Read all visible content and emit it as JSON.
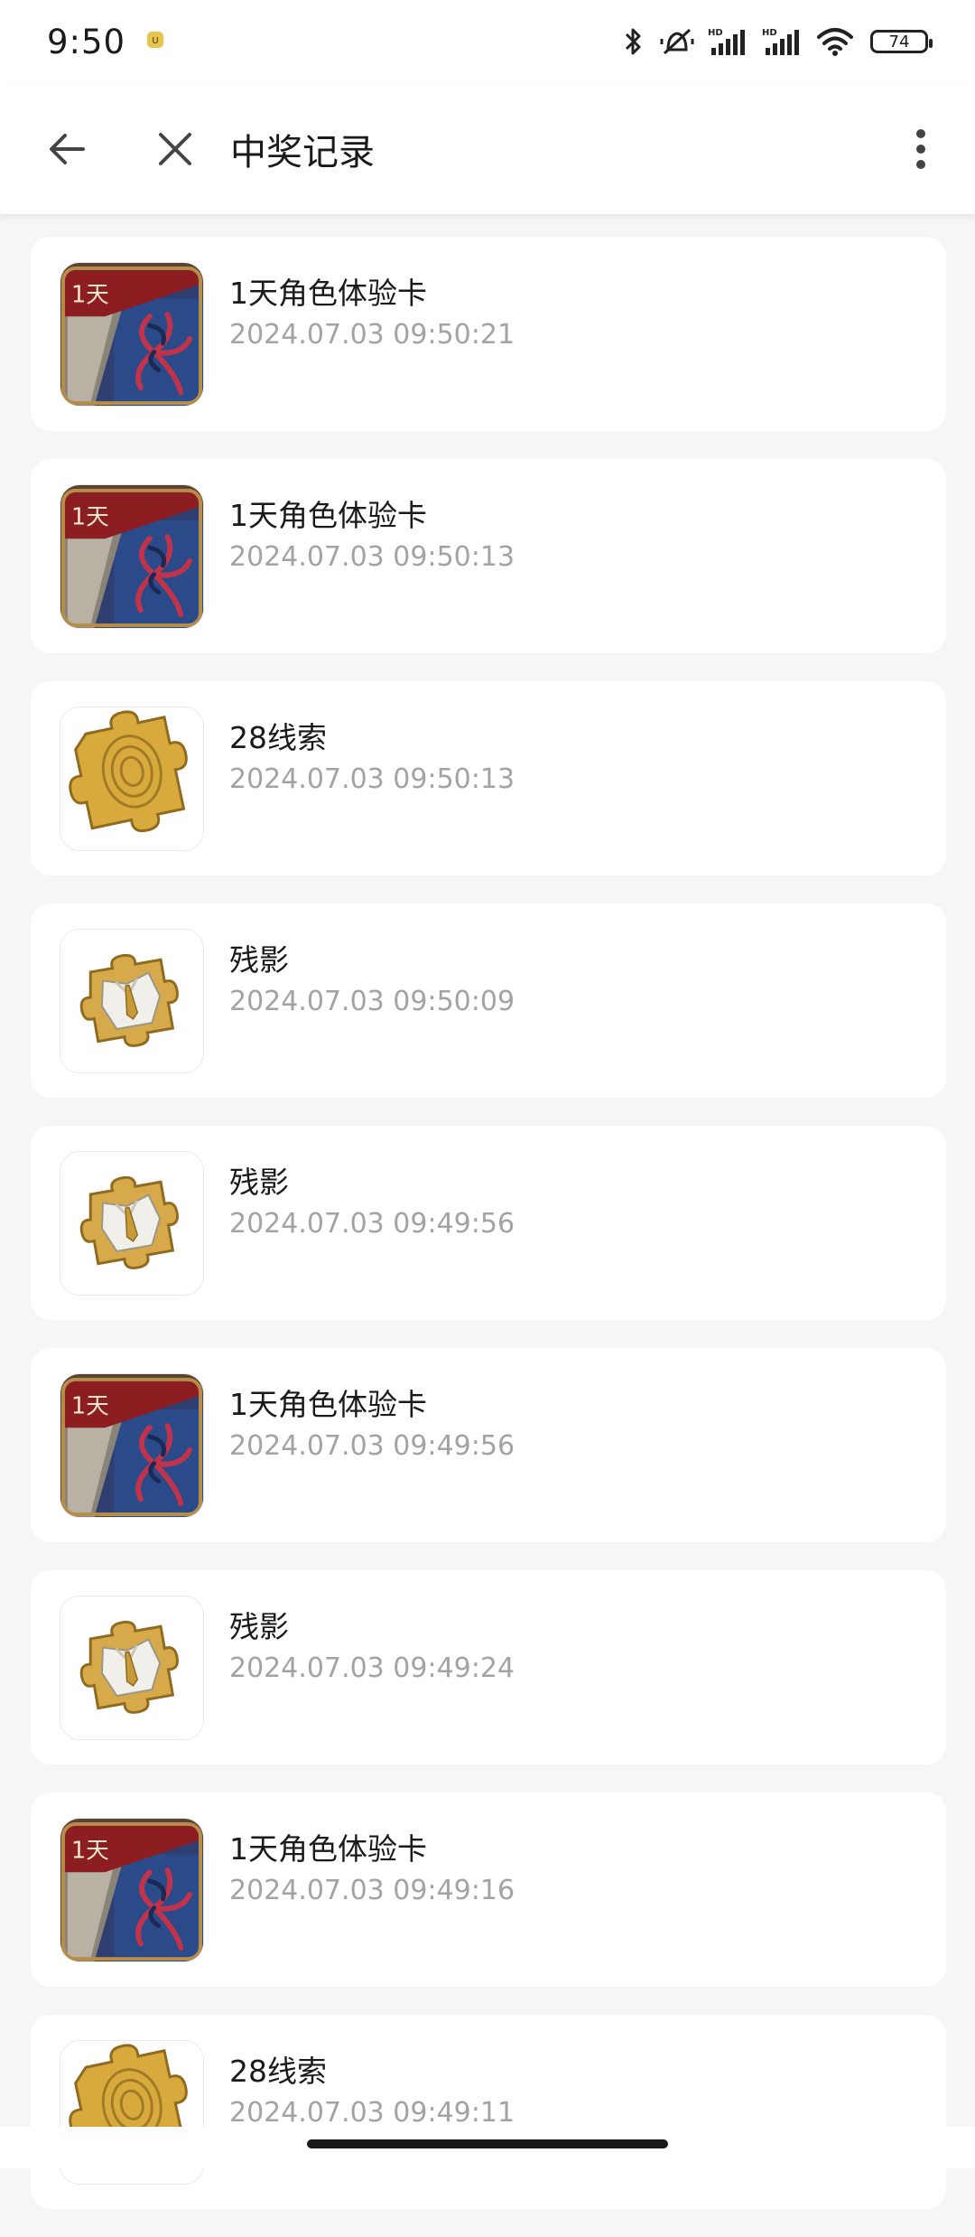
{
  "status_bar": {
    "time": "9:50",
    "battery": "74",
    "icons": [
      "notification-app-icon",
      "bluetooth-icon",
      "vibrate-off-icon",
      "hd-signal-icon",
      "hd-signal-icon",
      "wifi-icon",
      "battery-icon"
    ]
  },
  "app_bar": {
    "title": "中奖记录",
    "back_icon": "arrow-left-icon",
    "close_icon": "close-icon",
    "more_icon": "more-vertical-icon"
  },
  "records": [
    {
      "name": "1天角色体验卡",
      "time": "2024.07.03 09:50:21",
      "icon": "role-card-icon"
    },
    {
      "name": "1天角色体验卡",
      "time": "2024.07.03 09:50:13",
      "icon": "role-card-icon"
    },
    {
      "name": "28线索",
      "time": "2024.07.03 09:50:13",
      "icon": "gold-puzzle-icon"
    },
    {
      "name": "残影",
      "time": "2024.07.03 09:50:09",
      "icon": "afterimage-puzzle-icon"
    },
    {
      "name": "残影",
      "time": "2024.07.03 09:49:56",
      "icon": "afterimage-puzzle-icon"
    },
    {
      "name": "1天角色体验卡",
      "time": "2024.07.03 09:49:56",
      "icon": "role-card-icon"
    },
    {
      "name": "残影",
      "time": "2024.07.03 09:49:24",
      "icon": "afterimage-puzzle-icon"
    },
    {
      "name": "1天角色体验卡",
      "time": "2024.07.03 09:49:16",
      "icon": "role-card-icon"
    },
    {
      "name": "28线索",
      "time": "2024.07.03 09:49:11",
      "icon": "gold-puzzle-icon"
    }
  ],
  "card_badge_text": "1天",
  "colors": {
    "background": "#f6f6f6",
    "card": "#ffffff",
    "text_primary": "#1a1a1a",
    "text_secondary": "#a3a3a3",
    "gold": "#d8a93c",
    "card_red": "#8c1d20",
    "card_blue": "#2b4a8a"
  }
}
